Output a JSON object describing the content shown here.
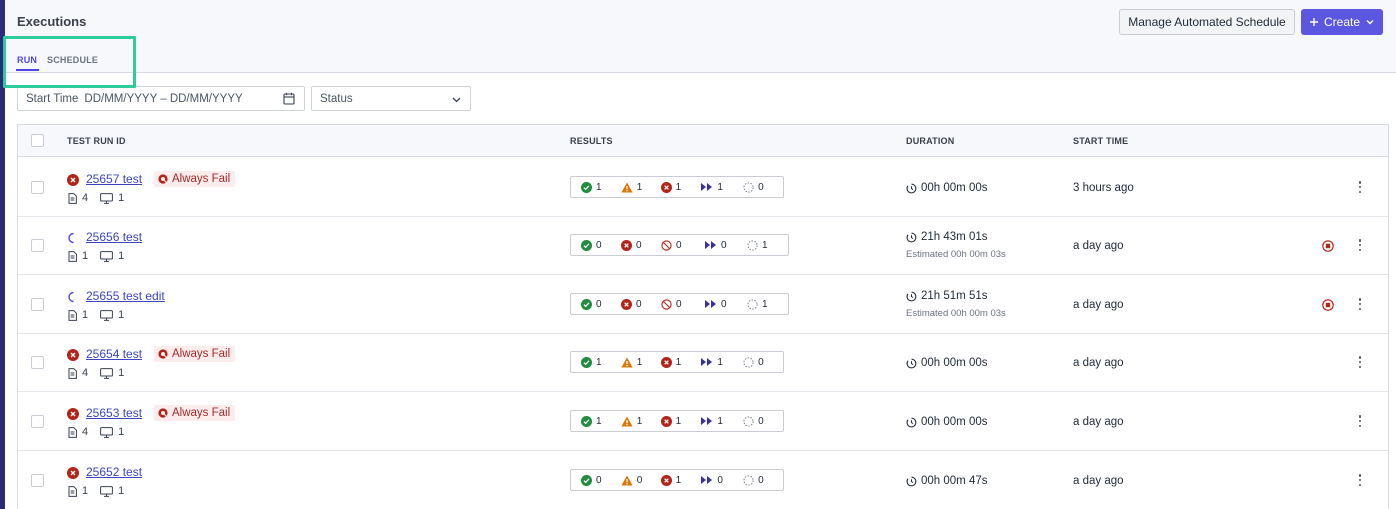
{
  "page": {
    "title": "Executions",
    "manage_label": "Manage Automated Schedule",
    "create_label": "Create"
  },
  "tabs": [
    {
      "label": "RUN",
      "active": true
    },
    {
      "label": "SCHEDULE",
      "active": false
    }
  ],
  "filters": {
    "date_label": "Start Time",
    "date_placeholder": "DD/MM/YYYY – DD/MM/YYYY",
    "status_placeholder": "Status"
  },
  "columns": {
    "id": "TEST RUN ID",
    "results": "RESULTS",
    "duration": "DURATION",
    "start": "START TIME"
  },
  "colors": {
    "accent": "#4f46e5",
    "create_bg": "#5b57e0",
    "passed": "#1e8e3e",
    "failed": "#b42318",
    "warning": "#d97706",
    "skipped": "#3730a3",
    "highlight": "#2ecc9a"
  },
  "rows": [
    {
      "id_text": "25657 test",
      "status": "failed",
      "badge": "Always Fail",
      "docs": "4",
      "machines": "1",
      "results": [
        {
          "type": "passed",
          "value": "1"
        },
        {
          "type": "warning",
          "value": "1"
        },
        {
          "type": "failed",
          "value": "1"
        },
        {
          "type": "skipped",
          "value": "1"
        },
        {
          "type": "pending",
          "value": "0"
        }
      ],
      "duration": "00h 00m 00s",
      "estimated": "",
      "start": "3 hours ago",
      "running": false
    },
    {
      "id_text": "25656 test",
      "status": "running",
      "badge": "",
      "docs": "1",
      "machines": "1",
      "results": [
        {
          "type": "passed",
          "value": "0"
        },
        {
          "type": "failed",
          "value": "0"
        },
        {
          "type": "cancelled",
          "value": "0"
        },
        {
          "type": "skipped",
          "value": "0"
        },
        {
          "type": "pending",
          "value": "1"
        }
      ],
      "duration": "21h 43m 01s",
      "estimated": "Estimated 00h 00m 03s",
      "start": "a day ago",
      "running": true
    },
    {
      "id_text": "25655 test edit",
      "status": "running",
      "badge": "",
      "docs": "1",
      "machines": "1",
      "results": [
        {
          "type": "passed",
          "value": "0"
        },
        {
          "type": "failed",
          "value": "0"
        },
        {
          "type": "cancelled",
          "value": "0"
        },
        {
          "type": "skipped",
          "value": "0"
        },
        {
          "type": "pending",
          "value": "1"
        }
      ],
      "duration": "21h 51m 51s",
      "estimated": "Estimated 00h 00m 03s",
      "start": "a day ago",
      "running": true
    },
    {
      "id_text": "25654 test",
      "status": "failed",
      "badge": "Always Fail",
      "docs": "4",
      "machines": "1",
      "results": [
        {
          "type": "passed",
          "value": "1"
        },
        {
          "type": "warning",
          "value": "1"
        },
        {
          "type": "failed",
          "value": "1"
        },
        {
          "type": "skipped",
          "value": "1"
        },
        {
          "type": "pending",
          "value": "0"
        }
      ],
      "duration": "00h 00m 00s",
      "estimated": "",
      "start": "a day ago",
      "running": false
    },
    {
      "id_text": "25653 test",
      "status": "failed",
      "badge": "Always Fail",
      "docs": "4",
      "machines": "1",
      "results": [
        {
          "type": "passed",
          "value": "1"
        },
        {
          "type": "warning",
          "value": "1"
        },
        {
          "type": "failed",
          "value": "1"
        },
        {
          "type": "skipped",
          "value": "1"
        },
        {
          "type": "pending",
          "value": "0"
        }
      ],
      "duration": "00h 00m 00s",
      "estimated": "",
      "start": "a day ago",
      "running": false
    },
    {
      "id_text": "25652 test",
      "status": "failed",
      "badge": "",
      "docs": "1",
      "machines": "1",
      "results": [
        {
          "type": "passed",
          "value": "0"
        },
        {
          "type": "warning",
          "value": "0"
        },
        {
          "type": "failed",
          "value": "1"
        },
        {
          "type": "skipped",
          "value": "0"
        },
        {
          "type": "pending",
          "value": "0"
        }
      ],
      "duration": "00h 00m 47s",
      "estimated": "",
      "start": "a day ago",
      "running": false
    }
  ]
}
